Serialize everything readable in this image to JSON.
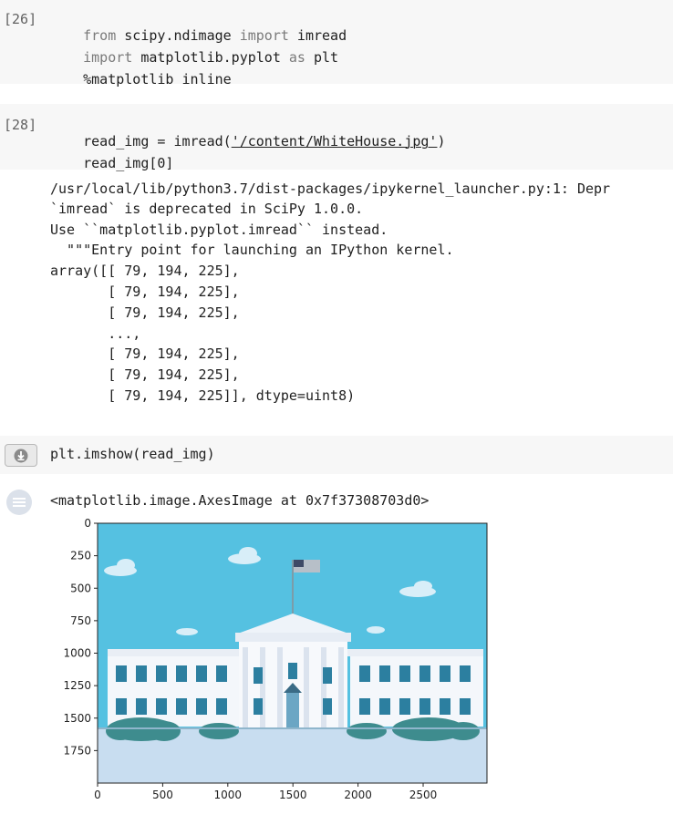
{
  "cells": [
    {
      "prompt": "[26]",
      "lines": [
        {
          "kw": "from",
          "t1": " scipy.ndimage ",
          "kw2": "import",
          "t2": " imread"
        },
        {
          "kw": "import",
          "t1": " matplotlib.pyplot ",
          "kw2": "as",
          "t2": " plt"
        },
        {
          "kw": "",
          "t1": "%matplotlib inline",
          "kw2": "",
          "t2": ""
        }
      ]
    },
    {
      "prompt": "[28]",
      "line1_pre": "read_img = imread(",
      "line1_str": "'/content/WhiteHouse.jpg'",
      "line1_post": ")",
      "line2": "read_img[0]",
      "output": [
        "/usr/local/lib/python3.7/dist-packages/ipykernel_launcher.py:1: Depr",
        "`imread` is deprecated in SciPy 1.0.0.",
        "Use ``matplotlib.pyplot.imread`` instead.",
        "  \"\"\"Entry point for launching an IPython kernel.",
        "array([[ 79, 194, 225],",
        "       [ 79, 194, 225],",
        "       [ 79, 194, 225],",
        "       ...,",
        "       [ 79, 194, 225],",
        "       [ 79, 194, 225],",
        "       [ 79, 194, 225]], dtype=uint8)"
      ]
    },
    {
      "line": "plt.imshow(read_img)",
      "output": "<matplotlib.image.AxesImage at 0x7f37308703d0>"
    }
  ],
  "chart_data": {
    "type": "image",
    "title": "",
    "xlabel": "",
    "ylabel": "",
    "xticks": [
      0,
      500,
      1000,
      1500,
      2000,
      2500
    ],
    "yticks": [
      0,
      250,
      500,
      750,
      1000,
      1250,
      1500,
      1750
    ],
    "xlim": [
      0,
      2990
    ],
    "ylim": [
      2000,
      0
    ],
    "colors": {
      "sky": "#55c1e1",
      "ground": "#c8ddf0",
      "building": "#f4f7fb",
      "windows": "#2c7fa0",
      "bushes": "#3e8c8e",
      "clouds": "#d8eef8"
    }
  }
}
